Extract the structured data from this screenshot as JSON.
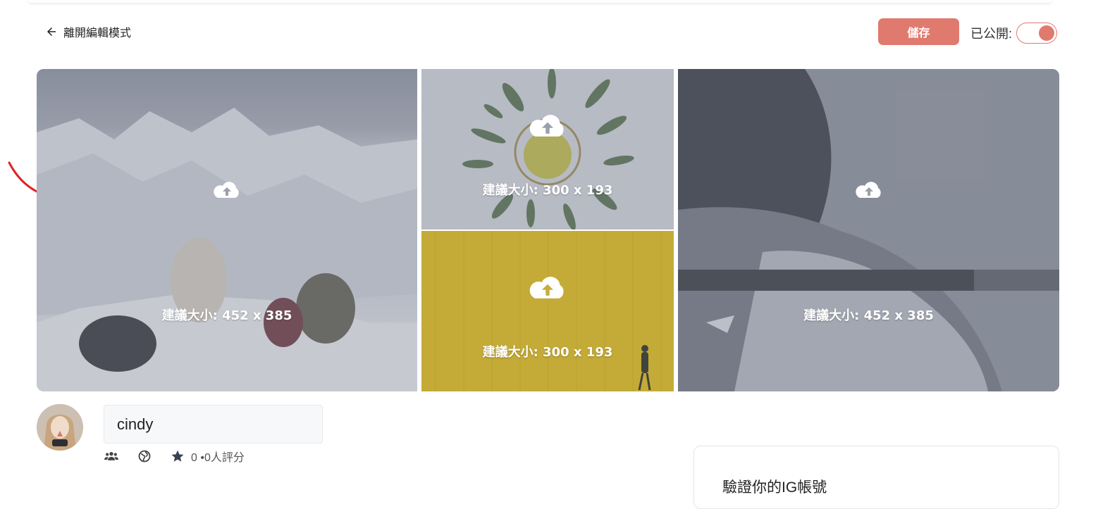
{
  "header": {
    "back_label": "離開編輯模式",
    "save_label": "儲存",
    "public_label": "已公開:",
    "public_on": true,
    "accent_color": "#e07a6f"
  },
  "gallery": {
    "tiles": [
      {
        "caption": "建議大小: 452 x 385",
        "icon": "cloud-upload-icon"
      },
      {
        "caption": "建議大小: 300 x 193",
        "icon": "cloud-upload-icon"
      },
      {
        "caption": "建議大小: 300 x 193",
        "icon": "cloud-upload-icon"
      },
      {
        "caption": "建議大小: 452 x 385",
        "icon": "cloud-upload-icon"
      }
    ]
  },
  "profile": {
    "name": "cindy",
    "rating_text": "0 •0人評分",
    "icons": [
      "users-icon",
      "globe-icon",
      "star-icon"
    ]
  },
  "ig_card": {
    "title": "驗證你的IG帳號"
  }
}
